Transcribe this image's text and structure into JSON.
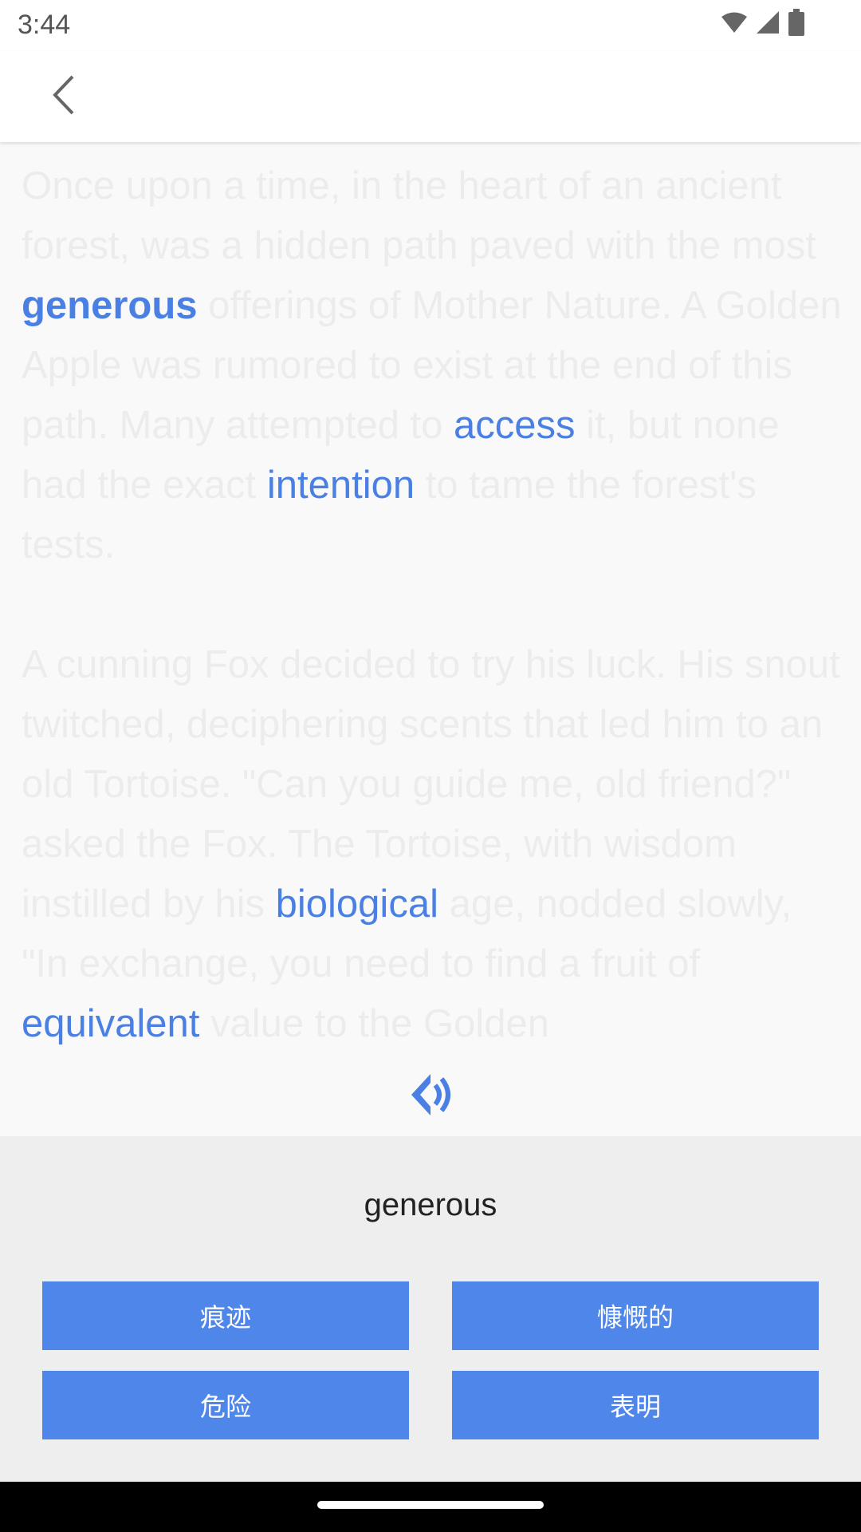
{
  "status_bar": {
    "time": "3:44",
    "icons": [
      "wifi-icon",
      "signal-icon",
      "battery-icon"
    ]
  },
  "app_bar": {
    "back_icon": "chevron-left-icon"
  },
  "story": {
    "paragraphs": [
      {
        "segments": [
          {
            "text": "Once upon a time, in the heart of an ancient forest, was a hidden path paved with the most "
          },
          {
            "text": "generous",
            "keyword": true,
            "selected": true
          },
          {
            "text": " offerings of Mother Nature. A Golden Apple was rumored to exist at the end of this path. Many attempted to "
          },
          {
            "text": "access",
            "keyword": true
          },
          {
            "text": " it, but none had the exact "
          },
          {
            "text": "intention",
            "keyword": true
          },
          {
            "text": " to tame the forest's tests."
          }
        ]
      },
      {
        "segments": [
          {
            "text": "A cunning Fox decided to try his luck. His snout twitched, deciphering scents that led him to an old Tortoise. \"Can you guide me, old friend?\" asked the Fox. The Tortoise, with wisdom instilled by his "
          },
          {
            "text": "biological",
            "keyword": true
          },
          {
            "text": " age, nodded slowly, \"In exchange, you need to find a fruit of "
          },
          {
            "text": "equivalent",
            "keyword": true
          },
          {
            "text": " value to the Golden"
          }
        ]
      }
    ],
    "speaker_icon": "speaker-icon"
  },
  "quiz": {
    "word": "generous",
    "options": [
      "痕迹",
      "慷慨的",
      "危险",
      "表明"
    ]
  },
  "colors": {
    "accent": "#4a7fe3",
    "button": "#4e86ea",
    "faded_text": "#ececec",
    "panel": "#eeeeee"
  }
}
